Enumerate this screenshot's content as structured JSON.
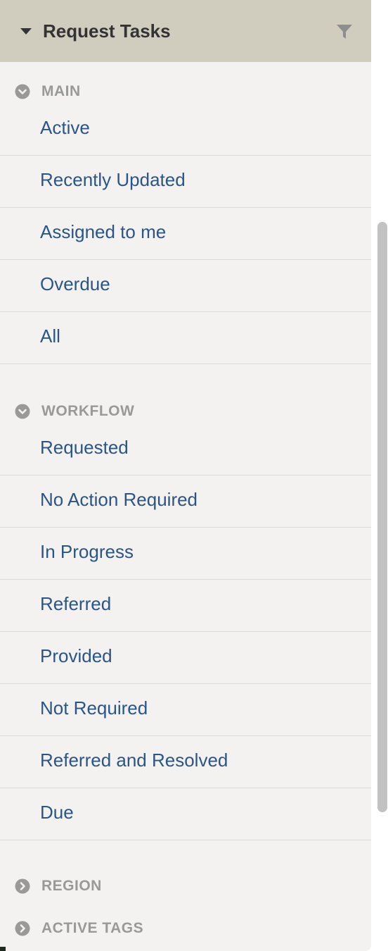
{
  "panel": {
    "title": "Request Tasks",
    "header_icon": "caret-down-icon",
    "filter_icon": "filter-icon"
  },
  "sections": {
    "main": {
      "label": "MAIN",
      "state": "expanded",
      "items": [
        {
          "label": "Active"
        },
        {
          "label": "Recently Updated"
        },
        {
          "label": "Assigned to me"
        },
        {
          "label": "Overdue"
        },
        {
          "label": "All"
        }
      ]
    },
    "workflow": {
      "label": "WORKFLOW",
      "state": "expanded",
      "items": [
        {
          "label": "Requested"
        },
        {
          "label": "No Action Required"
        },
        {
          "label": "In Progress"
        },
        {
          "label": "Referred"
        },
        {
          "label": "Provided"
        },
        {
          "label": "Not Required"
        },
        {
          "label": "Referred and Resolved"
        },
        {
          "label": "Due"
        }
      ]
    },
    "region": {
      "label": "REGION",
      "state": "collapsed"
    },
    "active_tags": {
      "label": "ACTIVE TAGS",
      "state": "collapsed"
    }
  },
  "colors": {
    "header_bg": "#d0cdbf",
    "panel_bg": "#f3f2f0",
    "link": "#2b5588",
    "section_label": "#999999",
    "divider": "#dcdad6"
  }
}
